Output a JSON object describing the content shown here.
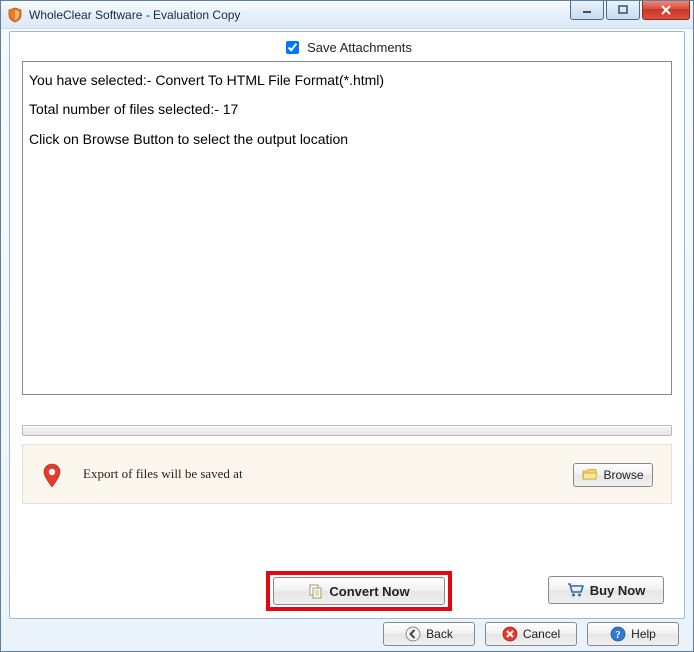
{
  "window": {
    "title": "WholeClear Software - Evaluation Copy"
  },
  "saveAttachments": {
    "label": "Save Attachments",
    "checked": true
  },
  "message": {
    "line1": "You have selected:- Convert To HTML File Format(*.html)",
    "line2": "Total number of files selected:- 17",
    "line3": "Click on Browse Button to select the output location"
  },
  "exportPanel": {
    "text": "Export of files will be saved at",
    "browseLabel": "Browse"
  },
  "actions": {
    "convertLabel": "Convert Now",
    "buyLabel": "Buy Now"
  },
  "footer": {
    "backLabel": "Back",
    "cancelLabel": "Cancel",
    "helpLabel": "Help"
  },
  "icons": {
    "folder": "folder-icon",
    "copy": "copy-icon",
    "cart": "cart-icon",
    "backArrow": "back-arrow-icon",
    "cancelX": "cancel-x-icon",
    "helpQ": "help-q-icon",
    "pin": "map-pin-icon",
    "app": "app-icon"
  },
  "colors": {
    "highlight": "#e30613",
    "panelBg": "#fbf6ee"
  }
}
